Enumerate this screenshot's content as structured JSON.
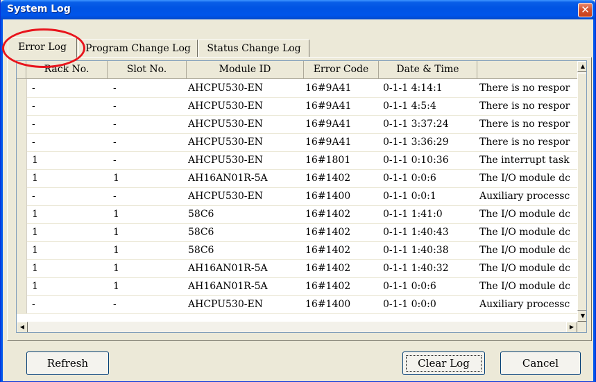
{
  "window": {
    "title": "System Log",
    "close_glyph": "✕"
  },
  "tabs": [
    {
      "label": "Error Log"
    },
    {
      "label": "Program Change Log"
    },
    {
      "label": "Status Change Log"
    }
  ],
  "table": {
    "columns": [
      "Rack No.",
      "Slot No.",
      "Module ID",
      "Error Code",
      "Date & Time",
      ""
    ],
    "rows": [
      [
        "-",
        "-",
        "AHCPU530-EN",
        "16#9A41",
        "0-1-1  4:14:1",
        "There is no respor"
      ],
      [
        "-",
        "-",
        "AHCPU530-EN",
        "16#9A41",
        "0-1-1  4:5:4",
        "There is no respor"
      ],
      [
        "-",
        "-",
        "AHCPU530-EN",
        "16#9A41",
        "0-1-1  3:37:24",
        "There is no respor"
      ],
      [
        "-",
        "-",
        "AHCPU530-EN",
        "16#9A41",
        "0-1-1  3:36:29",
        "There is no respor"
      ],
      [
        "1",
        "-",
        "AHCPU530-EN",
        "16#1801",
        "0-1-1  0:10:36",
        "The interrupt task"
      ],
      [
        "1",
        "1",
        "AH16AN01R-5A",
        "16#1402",
        "0-1-1  0:0:6",
        "The I/O module dc"
      ],
      [
        "-",
        "-",
        "AHCPU530-EN",
        "16#1400",
        "0-1-1  0:0:1",
        "Auxiliary processc"
      ],
      [
        "1",
        "1",
        "58C6",
        "16#1402",
        "0-1-1  1:41:0",
        "The I/O module dc"
      ],
      [
        "1",
        "1",
        "58C6",
        "16#1402",
        "0-1-1  1:40:43",
        "The I/O module dc"
      ],
      [
        "1",
        "1",
        "58C6",
        "16#1402",
        "0-1-1  1:40:38",
        "The I/O module dc"
      ],
      [
        "1",
        "1",
        "AH16AN01R-5A",
        "16#1402",
        "0-1-1  1:40:32",
        "The I/O module dc"
      ],
      [
        "1",
        "1",
        "AH16AN01R-5A",
        "16#1402",
        "0-1-1  0:0:6",
        "The I/O module dc"
      ],
      [
        "-",
        "-",
        "AHCPU530-EN",
        "16#1400",
        "0-1-1  0:0:0",
        "Auxiliary processc"
      ]
    ]
  },
  "scroll": {
    "up": "▲",
    "down": "▼",
    "left": "◀",
    "right": "▶"
  },
  "buttons": {
    "refresh": "Refresh",
    "clear_log": "Clear Log",
    "cancel": "Cancel"
  }
}
